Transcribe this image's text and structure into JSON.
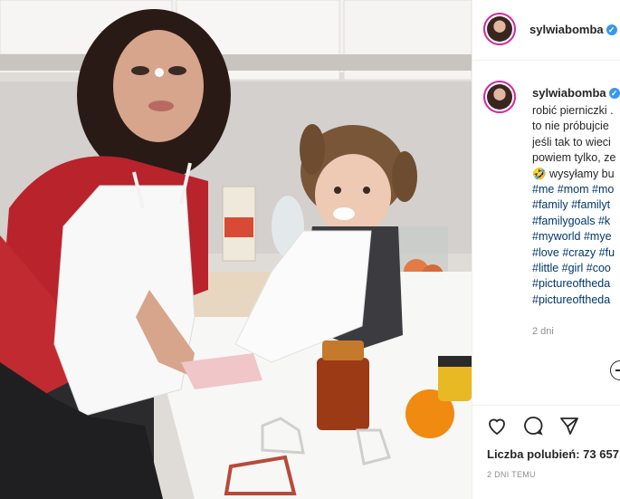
{
  "post": {
    "username": "sylwiabomba",
    "verified_badge": "✓",
    "caption_lines": [
      {
        "text": "robić pierniczki ."
      },
      {
        "text": "to nie próbujcie"
      },
      {
        "text": "jeśli tak to wieci"
      },
      {
        "text": "powiem tylko, ze"
      },
      {
        "text": "🤣 wysyłamy bu"
      }
    ],
    "hashtag_lines": [
      "#me #mom #mo",
      "#family #familyt",
      "#familygoals #k",
      "#myworld #mye",
      "#love #crazy #fu",
      "#little #girl #coo",
      "#pictureofthedа",
      "#pictureofthedа"
    ],
    "comment_time": "2 dni",
    "likes_text": "Liczba polubień: 73 657",
    "date_text": "2 DNI TEMU"
  },
  "icons": [
    "heart-icon",
    "comment-icon",
    "share-icon",
    "more-icon"
  ],
  "colors": {
    "link": "#00376b",
    "verified": "#3897f0",
    "ring": "#d6249f",
    "muted": "#8e8e8e"
  }
}
